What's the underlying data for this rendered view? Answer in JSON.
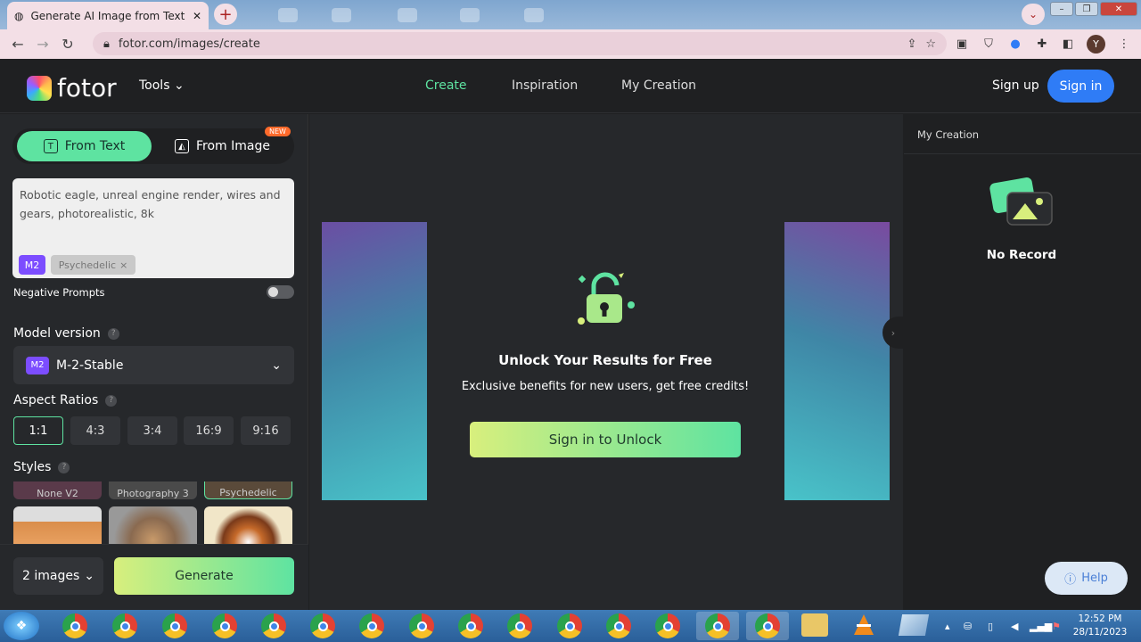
{
  "browser": {
    "tab_title": "Generate AI Image from Text Onl",
    "url": "fotor.com/images/create",
    "profile_initial": "Y"
  },
  "header": {
    "logo_text": "fotor",
    "tools": "Tools",
    "nav": [
      "Create",
      "Inspiration",
      "My Creation"
    ],
    "sign_up": "Sign up",
    "sign_in": "Sign in"
  },
  "left": {
    "from_text": "From Text",
    "from_image": "From Image",
    "new_badge": "NEW",
    "prompt": "Robotic eagle, unreal engine render, wires and gears, photorealistic, 8k",
    "model_tag": "M2",
    "style_tag": "Psychedelic",
    "style_tag_close": "×",
    "negative_prompts": "Negative Prompts",
    "model_version_label": "Model version",
    "model_badge": "M2",
    "model_name": "M-2-Stable",
    "aspect_label": "Aspect Ratios",
    "aspects": [
      "1:1",
      "4:3",
      "3:4",
      "16:9",
      "9:16"
    ],
    "styles_label": "Styles",
    "style_captions": [
      "None V2",
      "Photography 3",
      "Psychedelic"
    ],
    "image_count": "2 images",
    "generate": "Generate"
  },
  "center": {
    "title": "Unlock Your Results for Free",
    "subtitle": "Exclusive benefits for new users, get free credits!",
    "button": "Sign in to Unlock"
  },
  "right": {
    "section_title": "My Creation",
    "empty_text": "No Record",
    "help": "Help"
  },
  "taskbar": {
    "time": "12:52 PM",
    "date": "28/11/2023"
  },
  "colors": {
    "accent": "#5ee3a1",
    "sign_in_blue": "#2f7cf6",
    "new_badge": "#ff6a2b",
    "model_purple": "#7c4dff"
  }
}
